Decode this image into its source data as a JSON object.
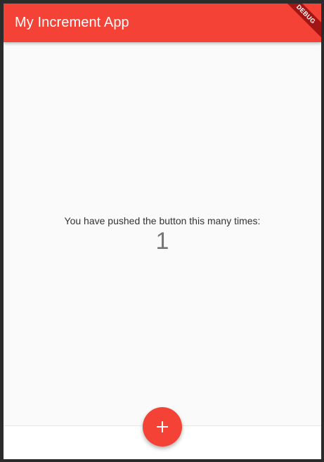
{
  "app_bar": {
    "title": "My Increment App",
    "color": "#f44336"
  },
  "debug_banner": {
    "label": "DEBUG"
  },
  "main": {
    "prompt": "You have pushed the button this many times:",
    "counter": "1"
  },
  "fab": {
    "icon": "add-icon",
    "color": "#f44336"
  }
}
